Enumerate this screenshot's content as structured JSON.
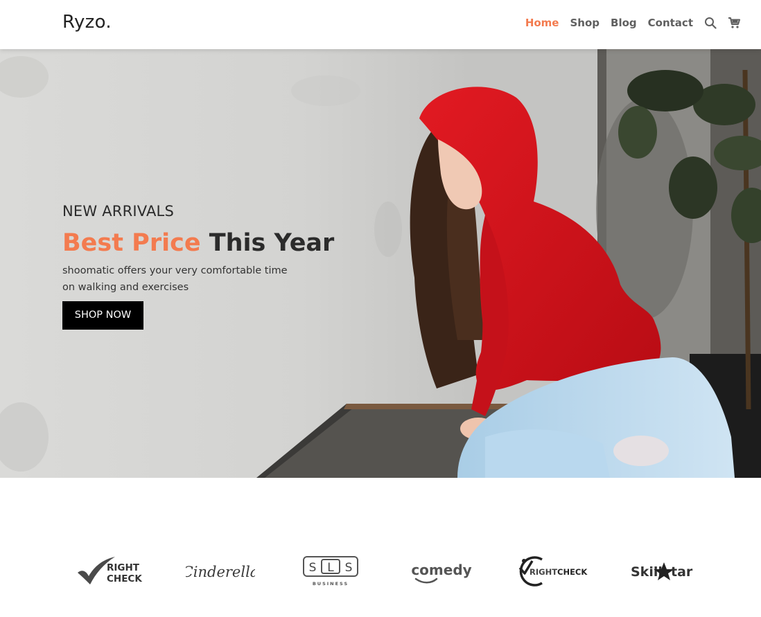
{
  "header": {
    "logo": "Ryzo.",
    "nav": [
      {
        "label": "Home",
        "active": true
      },
      {
        "label": "Shop",
        "active": false
      },
      {
        "label": "Blog",
        "active": false
      },
      {
        "label": "Contact",
        "active": false
      }
    ],
    "icons": [
      "search-icon",
      "cart-icon"
    ]
  },
  "hero": {
    "kicker": "NEW ARRIVALS",
    "title_accent": "Best Price",
    "title_rest": "This Year",
    "description": "shoomatic offers your very comfortable time on walking and exercises",
    "button_label": "SHOP NOW"
  },
  "brands": {
    "rightcheck1_top": "RIGHT",
    "rightcheck1_bottom": "CHECK",
    "cinderella": "Cinderella",
    "sls_letters": [
      "S",
      "L",
      "S"
    ],
    "sls_sub": "BUSINESS",
    "comedy": "comedy",
    "rightcheck2_a": "RIGHT",
    "rightcheck2_b": "CHECK",
    "skillstar_a": "Skill",
    "skillstar_b": "tar"
  },
  "colors": {
    "accent": "#f37b4f",
    "nav_text": "#5f5f5f",
    "hoodie": "#d8121c",
    "button_bg": "#000000"
  }
}
